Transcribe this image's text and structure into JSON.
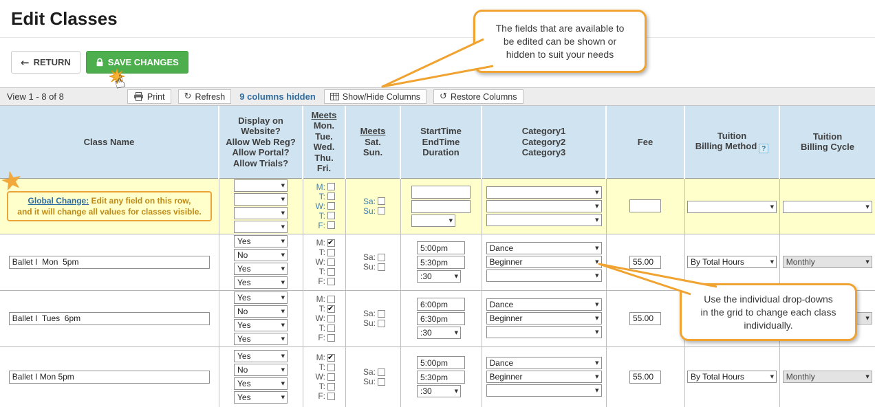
{
  "page": {
    "title": "Edit Classes"
  },
  "actions": {
    "return_label": "RETURN",
    "save_label": "SAVE CHANGES"
  },
  "toolbar": {
    "view_count": "View 1 - 8 of 8",
    "print_label": "Print",
    "refresh_label": "Refresh",
    "columns_hidden": "9 columns hidden",
    "show_hide_label": "Show/Hide Columns",
    "restore_label": "Restore Columns"
  },
  "callouts": {
    "top": {
      "line1": "The fields that are available to",
      "line2": "be edited can be shown or",
      "line3": "hidden to suit your needs"
    },
    "bottom": {
      "line1": "Use the individual drop-downs",
      "line2": "in the grid to change each class",
      "line3": "individually."
    }
  },
  "icons": {
    "back_arrow": "←",
    "refresh_glyph": "↻",
    "restore_glyph": "↺",
    "dropdown_arrow": "▼",
    "checkmark": "✔",
    "help": "?",
    "star": "★",
    "pointer_hand": "☝"
  },
  "colors": {
    "accent_orange": "#f0a330",
    "save_green": "#4cae4c",
    "header_blue": "#cfe3f0",
    "row_yellow": "#ffffcb",
    "link_blue": "#2e6da4",
    "text_orange": "#bf8a15",
    "toolbar_gray": "#ededed"
  },
  "table": {
    "headers": {
      "class_name": "Class Name",
      "display": [
        "Display on",
        "Website?",
        "Allow Web Reg?",
        "Allow Portal?",
        "Allow Trials?"
      ],
      "meets_week": {
        "title": "Meets",
        "days": [
          "Mon.",
          "Tue.",
          "Wed.",
          "Thu.",
          "Fri."
        ]
      },
      "meets_weekend": {
        "title": "Meets",
        "days": [
          "Sat.",
          "Sun."
        ]
      },
      "time": [
        "StartTime",
        "EndTime",
        "Duration"
      ],
      "category": [
        "Category1",
        "Category2",
        "Category3"
      ],
      "fee": "Fee",
      "billing_method_line1": "Tuition",
      "billing_method_line2": "Billing Method",
      "billing_cycle_line1": "Tuition",
      "billing_cycle_line2": "Billing Cycle"
    },
    "weekday_labels": [
      "M:",
      "T:",
      "W:",
      "T:",
      "F:"
    ],
    "weekend_labels": [
      "Sa:",
      "Su:"
    ],
    "global_row": {
      "link": "Global Change:",
      "text_line1": "Edit any field on this row,",
      "text_line2": "and it will change all values for classes visible."
    },
    "rows": [
      {
        "class_name": "Ballet I  Mon  5pm",
        "display": [
          "Yes",
          "No",
          "Yes",
          "Yes"
        ],
        "weekdays_checked": [
          true,
          false,
          false,
          false,
          false
        ],
        "start_time": "5:00pm",
        "end_time": "5:30pm",
        "duration": ":30",
        "categories": [
          "Dance",
          "Beginner",
          ""
        ],
        "fee": "55.00",
        "billing_method": "By Total Hours",
        "billing_cycle": "Monthly"
      },
      {
        "class_name": "Ballet I  Tues  6pm",
        "display": [
          "Yes",
          "No",
          "Yes",
          "Yes"
        ],
        "weekdays_checked": [
          false,
          true,
          false,
          false,
          false
        ],
        "start_time": "6:00pm",
        "end_time": "6:30pm",
        "duration": ":30",
        "categories": [
          "Dance",
          "Beginner",
          ""
        ],
        "fee": "55.00",
        "billing_method": "",
        "billing_cycle": "Monthly"
      },
      {
        "class_name": "Ballet I Mon 5pm",
        "display": [
          "Yes",
          "No",
          "Yes",
          "Yes"
        ],
        "weekdays_checked": [
          true,
          false,
          false,
          false,
          false
        ],
        "start_time": "5:00pm",
        "end_time": "5:30pm",
        "duration": ":30",
        "categories": [
          "Dance",
          "Beginner",
          ""
        ],
        "fee": "55.00",
        "billing_method": "By Total Hours",
        "billing_cycle": "Monthly"
      }
    ]
  }
}
